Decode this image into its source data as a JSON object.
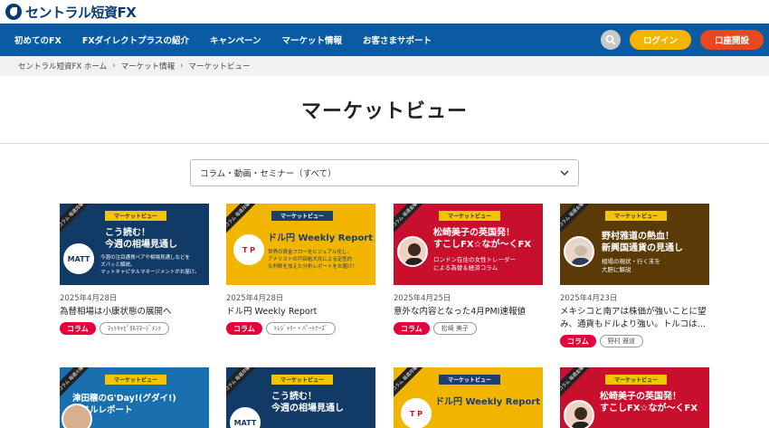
{
  "header": {
    "logo_text": "セントラル短資FX"
  },
  "nav": {
    "items": [
      "初めてのFX",
      "FXダイレクトプラスの紹介",
      "キャンペーン",
      "マーケット情報",
      "お客さまサポート"
    ],
    "login_label": "ログイン",
    "open_account_label": "口座開設"
  },
  "breadcrumb": [
    "セントラル短資FX ホーム",
    "マーケット情報",
    "マーケットビュー"
  ],
  "page": {
    "title": "マーケットビュー",
    "filter_value": "コラム・動画・セミナー（すべて）"
  },
  "colors": {
    "nav_bg": "#0b5aa4",
    "login": "#f4b400",
    "open_account": "#e8481c",
    "category_chip": "#e6003a"
  },
  "cards": [
    {
      "ribbon": "コラム 毎週月曜",
      "tag": "マーケットビュー",
      "thumb_heading": "こう読む！\n今週の相場見通し",
      "thumb_sub": "今週の注目通貨ペアや相場見通しなどを\nズバッと解説。\nマットキャピタルマネージメントがお届け。",
      "logo": "MATT",
      "date": "2025年4月28日",
      "title": "為替相場は小康状態の展開へ",
      "category": "コラム",
      "writer": "ﾏｯﾄｷｬﾋﾟﾀﾙﾏﾈｰｼﾞﾒﾝﾄ"
    },
    {
      "ribbon": "コラム 毎週月曜",
      "tag": "マーケットビュー",
      "thumb_heading": "ドル円 Weekly Report",
      "thumb_sub": "世界の資金フローをビジュアル化し、\nアナリストの戸田裕大氏による定性的\nな判断を加えた分析レポートをお届け！",
      "logo": "T P",
      "date": "2025年4月28日",
      "title": "ドル円 Weekly Report",
      "category": "コラム",
      "writer": "ﾄﾚｼﾞｬﾘｰ・ﾊﾟｰﾄﾅｰｽﾞ"
    },
    {
      "ribbon": "コラム 毎週金曜",
      "tag": "マーケットビュー",
      "thumb_heading": "松崎美子の英国発！\nすこしFX☆なが～くFX",
      "thumb_sub": "ロンドン在住の女性トレーダー\nによる為替＆経済コラム",
      "date": "2025年4月25日",
      "title": "意外な内容となった4月PMI速報値",
      "category": "コラム",
      "writer": "松崎 美子"
    },
    {
      "ribbon": "コラム 毎週水曜",
      "tag": "マーケットビュー",
      "thumb_heading": "野村雅道の熱血！\n新興国通貨の見通し",
      "thumb_sub": "相場の現状・行く末を\n大胆に解説",
      "date": "2025年4月23日",
      "title": "メキシコと南アは株価が強いことに望み、通貨もドルより強い。トルコは…",
      "category": "コラム",
      "writer": "野村 雅道"
    },
    {
      "ribbon": "コラム 毎週火曜",
      "tag": "マーケットビュー",
      "thumb_heading": "津田穣のG'Day!(グダイ!)\n豪ドルレポート"
    },
    {
      "ribbon": "コラム 毎週月曜",
      "tag": "マーケットビュー",
      "thumb_heading": "こう読む！\n今週の相場見通し",
      "logo": "MATT"
    },
    {
      "ribbon": "コラム 毎週月曜",
      "tag": "マーケットビュー",
      "thumb_heading": "ドル円 Weekly Report",
      "logo": "T P"
    },
    {
      "ribbon": "コラム 毎週金曜",
      "tag": "マーケットビュー",
      "thumb_heading": "松崎美子の英国発！\nすこしFX☆なが～くFX"
    }
  ]
}
